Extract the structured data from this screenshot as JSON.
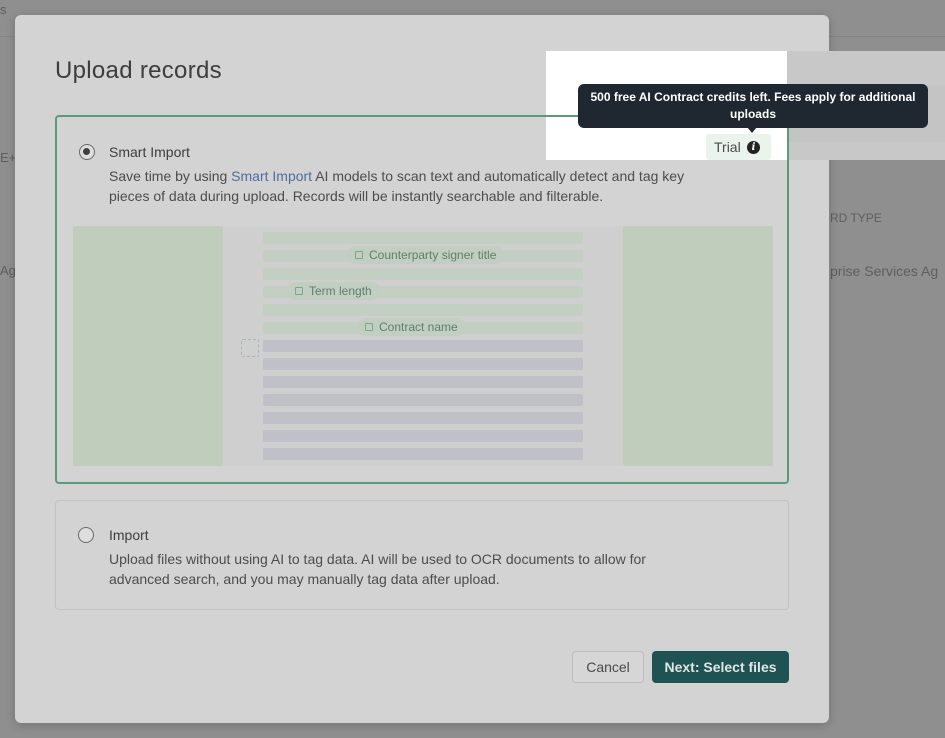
{
  "background": {
    "top_left_fragment": "s",
    "left_fragment_1": "E+/",
    "left_fragment_2": "Ag",
    "column_header_fragment": "RD TYPE",
    "row_value_fragment": "prise Services Ag"
  },
  "modal": {
    "title": "Upload records",
    "smart_import": {
      "title": "Smart Import",
      "desc_prefix": "Save time by using ",
      "desc_link": "Smart Import",
      "desc_suffix": " AI models to scan text and automatically detect and tag key pieces of data during upload. Records will be instantly searchable and filterable.",
      "selected": true,
      "badge": "Trial",
      "illustration_tags": [
        "Counterparty signer title",
        "Term length",
        "Contract name"
      ]
    },
    "import": {
      "title": "Import",
      "desc": "Upload files without using AI to tag data. AI will be used to OCR documents to allow for advanced search, and you may manually tag data after upload.",
      "selected": false
    },
    "buttons": {
      "cancel": "Cancel",
      "next": "Next: Select files"
    }
  },
  "tooltip": {
    "text": "500 free AI Contract credits left. Fees apply for additional uploads"
  },
  "icons": {
    "info": "info-icon",
    "tag": "tag-icon"
  },
  "colors": {
    "accent_green": "#5c9a7d",
    "primary_button": "#1e5253",
    "tooltip_bg": "#1f2730",
    "link": "#4d6e9e"
  }
}
